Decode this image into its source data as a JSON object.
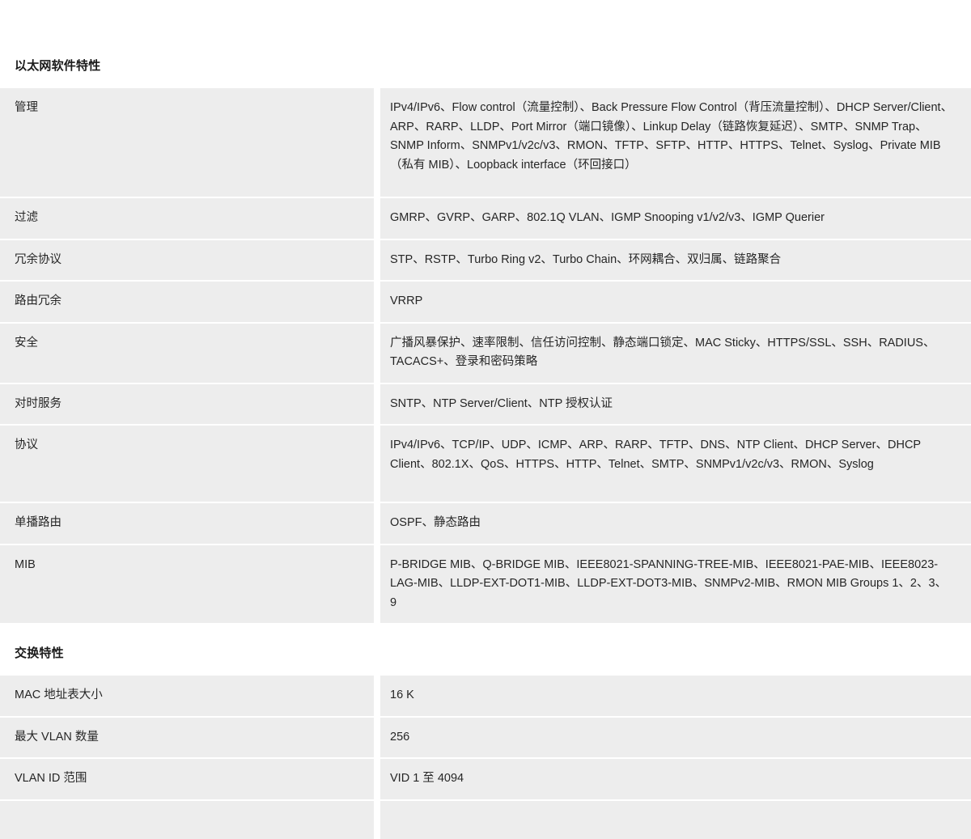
{
  "document": {
    "sections": [
      {
        "id": "ethernet-software-features",
        "title": "以太网软件特性",
        "rows": [
          {
            "label": "管理",
            "value": "IPv4/IPv6、Flow control（流量控制）、Back Pressure Flow Control（背压流量控制）、DHCP Server/Client、ARP、RARP、LLDP、Port Mirror（端口镜像）、Linkup Delay（链路恢复延迟）、SMTP、SNMP Trap、SNMP Inform、SNMPv1/v2c/v3、RMON、TFTP、SFTP、HTTP、HTTPS、Telnet、Syslog、Private MIB（私有 MIB）、Loopback interface（环回接口）",
            "height_class": "tall-1"
          },
          {
            "label": "过滤",
            "value": "GMRP、GVRP、GARP、802.1Q VLAN、IGMP Snooping v1/v2/v3、IGMP Querier",
            "height_class": "h-std"
          },
          {
            "label": "冗余协议",
            "value": "STP、RSTP、Turbo Ring v2、Turbo Chain、环网耦合、双归属、链路聚合",
            "height_class": "h-std"
          },
          {
            "label": "路由冗余",
            "value": "VRRP",
            "height_class": "h-std"
          },
          {
            "label": "安全",
            "value": "广播风暴保护、速率限制、信任访问控制、静态端口锁定、MAC Sticky、HTTPS/SSL、SSH、RADIUS、TACACS+、登录和密码策略",
            "height_class": "h-two"
          },
          {
            "label": "对时服务",
            "value": "SNTP、NTP Server/Client、NTP 授权认证",
            "height_class": "h-std"
          },
          {
            "label": "协议",
            "value": "IPv4/IPv6、TCP/IP、UDP、ICMP、ARP、RARP、TFTP、DNS、NTP Client、DHCP Server、DHCP Client、802.1X、QoS、HTTPS、HTTP、Telnet、SMTP、SNMPv1/v2c/v3、RMON、Syslog",
            "height_class": "h-three"
          },
          {
            "label": "单播路由",
            "value": "OSPF、静态路由",
            "height_class": "h-std"
          },
          {
            "label": "MIB",
            "value": "P-BRIDGE MIB、Q-BRIDGE MIB、IEEE8021-SPANNING-TREE-MIB、IEEE8021-PAE-MIB、IEEE8023-LAG-MIB、LLDP-EXT-DOT1-MIB、LLDP-EXT-DOT3-MIB、SNMPv2-MIB、RMON MIB Groups 1、2、3、9",
            "height_class": "h-three"
          }
        ]
      },
      {
        "id": "switching-features",
        "title": "交换特性",
        "rows": [
          {
            "label": "MAC 地址表大小",
            "value": "16 K",
            "height_class": "h-std"
          },
          {
            "label": "最大 VLAN 数量",
            "value": "256",
            "height_class": "h-std"
          },
          {
            "label": "VLAN ID 范围",
            "value": "VID 1 至 4094",
            "height_class": "h-std"
          },
          {
            "label": "",
            "value": "",
            "height_class": "h-std"
          }
        ]
      }
    ]
  },
  "theme": {
    "page_background": "#ffffff",
    "cell_background": "#ededed",
    "text_color": "#262626",
    "heading_color": "#1a1a1a"
  }
}
